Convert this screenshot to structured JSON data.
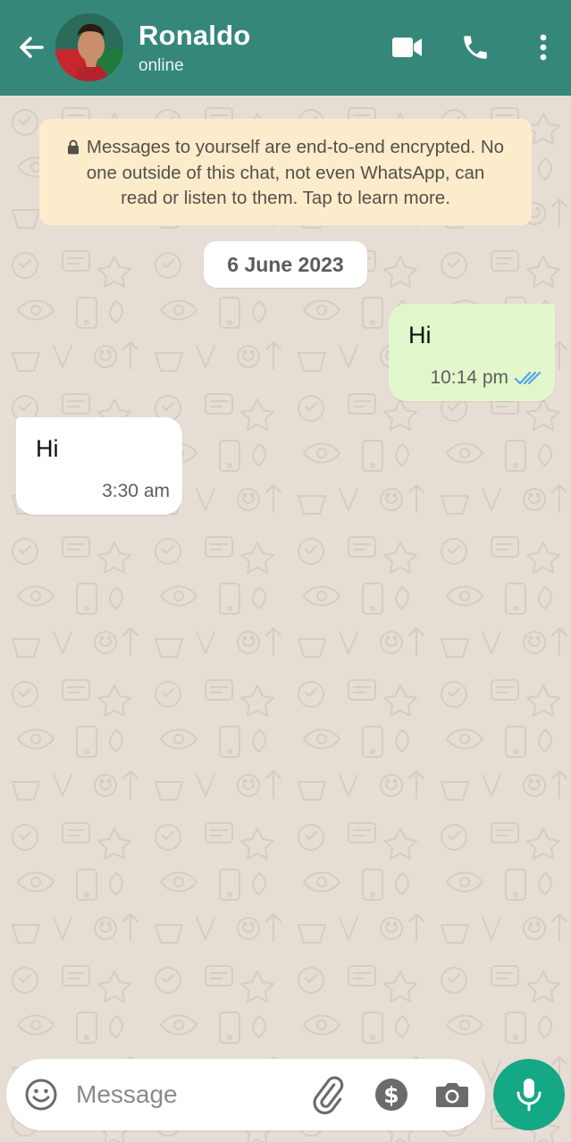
{
  "header": {
    "contact_name": "Ronaldo",
    "status": "online",
    "icons": [
      "back-arrow-icon",
      "video-call-icon",
      "voice-call-icon",
      "more-options-icon"
    ]
  },
  "system_note": {
    "text": "Messages to yourself are end-to-end encrypted. No one outside of this chat, not even WhatsApp, can read or listen to them. Tap to learn more."
  },
  "date_divider": "6 June 2023",
  "messages": [
    {
      "direction": "outgoing",
      "text": "Hi",
      "time": "10:14 pm",
      "status": "read"
    },
    {
      "direction": "incoming",
      "text": "Hi",
      "time": "3:30 am"
    }
  ],
  "composer": {
    "placeholder": "Message",
    "icons": [
      "emoji-icon",
      "attach-icon",
      "payment-icon",
      "camera-icon",
      "mic-icon"
    ]
  },
  "colors": {
    "header": "#35877a",
    "wallpaper": "#e6ddd4",
    "outgoing_bubble": "#e2f7cb",
    "incoming_bubble": "#ffffff",
    "system_note": "#fdeccb",
    "mic_button": "#15a884",
    "read_ticks": "#53a6e8"
  }
}
